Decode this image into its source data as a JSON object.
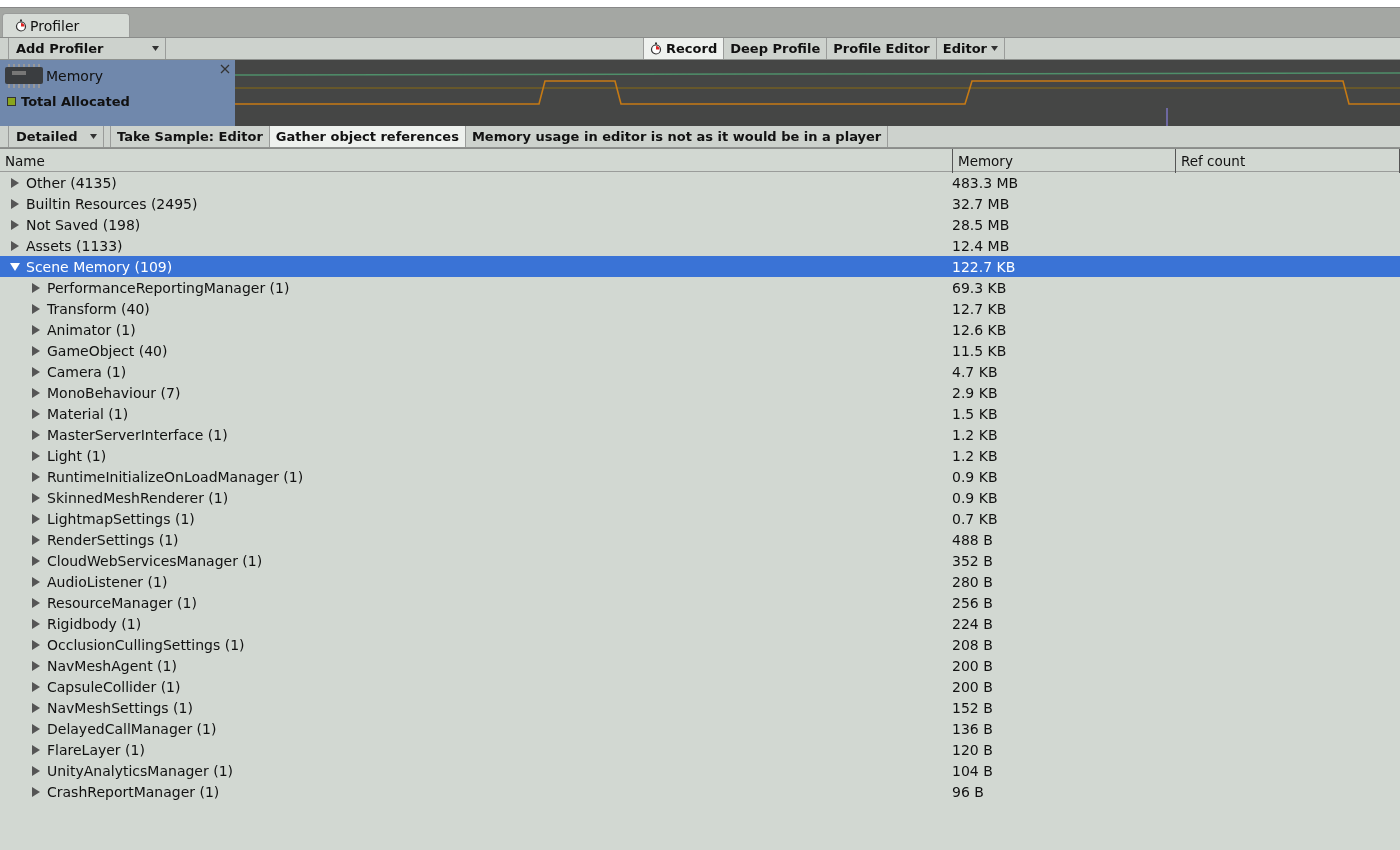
{
  "window": {
    "tab": "Profiler"
  },
  "toolbar": {
    "add_profiler": "Add Profiler",
    "buttons": [
      {
        "label": "Record",
        "selected": true,
        "kind": "record"
      },
      {
        "label": "Deep Profile",
        "selected": false,
        "kind": "plain"
      },
      {
        "label": "Profile Editor",
        "selected": false,
        "kind": "plain"
      },
      {
        "label": "Editor",
        "selected": false,
        "kind": "dropdown"
      }
    ]
  },
  "memory_panel": {
    "title": "Memory",
    "legend": [
      {
        "label": "Total Allocated",
        "color": "#8aa51c"
      }
    ]
  },
  "detail_toolbar": {
    "mode": "Detailed",
    "buttons": [
      {
        "label": "Take Sample: Editor",
        "selected": false
      },
      {
        "label": "Gather object references",
        "selected": true
      }
    ],
    "note": "Memory usage in editor is not as it would be in a player"
  },
  "table": {
    "columns": [
      "Name",
      "Memory",
      "Ref count"
    ],
    "rows": [
      {
        "name": "Other (4135)",
        "memory": "483.3 MB",
        "expanded": false,
        "selected": false
      },
      {
        "name": "Builtin Resources (2495)",
        "memory": "32.7 MB",
        "expanded": false,
        "selected": false
      },
      {
        "name": "Not Saved (198)",
        "memory": "28.5 MB",
        "expanded": false,
        "selected": false
      },
      {
        "name": "Assets (1133)",
        "memory": "12.4 MB",
        "expanded": false,
        "selected": false
      },
      {
        "name": "Scene Memory (109)",
        "memory": "122.7 KB",
        "expanded": true,
        "selected": true,
        "children": [
          {
            "name": "PerformanceReportingManager (1)",
            "memory": "69.3 KB",
            "expanded": false,
            "selected": false
          },
          {
            "name": "Transform (40)",
            "memory": "12.7 KB",
            "expanded": false,
            "selected": false
          },
          {
            "name": "Animator (1)",
            "memory": "12.6 KB",
            "expanded": false,
            "selected": false
          },
          {
            "name": "GameObject (40)",
            "memory": "11.5 KB",
            "expanded": false,
            "selected": false
          },
          {
            "name": "Camera (1)",
            "memory": "4.7 KB",
            "expanded": false,
            "selected": false
          },
          {
            "name": "MonoBehaviour (7)",
            "memory": "2.9 KB",
            "expanded": false,
            "selected": false
          },
          {
            "name": "Material (1)",
            "memory": "1.5 KB",
            "expanded": false,
            "selected": false
          },
          {
            "name": "MasterServerInterface (1)",
            "memory": "1.2 KB",
            "expanded": false,
            "selected": false
          },
          {
            "name": "Light (1)",
            "memory": "1.2 KB",
            "expanded": false,
            "selected": false
          },
          {
            "name": "RuntimeInitializeOnLoadManager (1)",
            "memory": "0.9 KB",
            "expanded": false,
            "selected": false
          },
          {
            "name": "SkinnedMeshRenderer (1)",
            "memory": "0.9 KB",
            "expanded": false,
            "selected": false
          },
          {
            "name": "LightmapSettings (1)",
            "memory": "0.7 KB",
            "expanded": false,
            "selected": false
          },
          {
            "name": "RenderSettings (1)",
            "memory": "488 B",
            "expanded": false,
            "selected": false
          },
          {
            "name": "CloudWebServicesManager (1)",
            "memory": "352 B",
            "expanded": false,
            "selected": false
          },
          {
            "name": "AudioListener (1)",
            "memory": "280 B",
            "expanded": false,
            "selected": false
          },
          {
            "name": "ResourceManager (1)",
            "memory": "256 B",
            "expanded": false,
            "selected": false
          },
          {
            "name": "Rigidbody (1)",
            "memory": "224 B",
            "expanded": false,
            "selected": false
          },
          {
            "name": "OcclusionCullingSettings (1)",
            "memory": "208 B",
            "expanded": false,
            "selected": false
          },
          {
            "name": "NavMeshAgent (1)",
            "memory": "200 B",
            "expanded": false,
            "selected": false
          },
          {
            "name": "CapsuleCollider (1)",
            "memory": "200 B",
            "expanded": false,
            "selected": false
          },
          {
            "name": "NavMeshSettings (1)",
            "memory": "152 B",
            "expanded": false,
            "selected": false
          },
          {
            "name": "DelayedCallManager (1)",
            "memory": "136 B",
            "expanded": false,
            "selected": false
          },
          {
            "name": "FlareLayer (1)",
            "memory": "120 B",
            "expanded": false,
            "selected": false
          },
          {
            "name": "UnityAnalyticsManager (1)",
            "memory": "104 B",
            "expanded": false,
            "selected": false
          },
          {
            "name": "CrashReportManager (1)",
            "memory": "96 B",
            "expanded": false,
            "selected": false
          }
        ]
      }
    ]
  }
}
